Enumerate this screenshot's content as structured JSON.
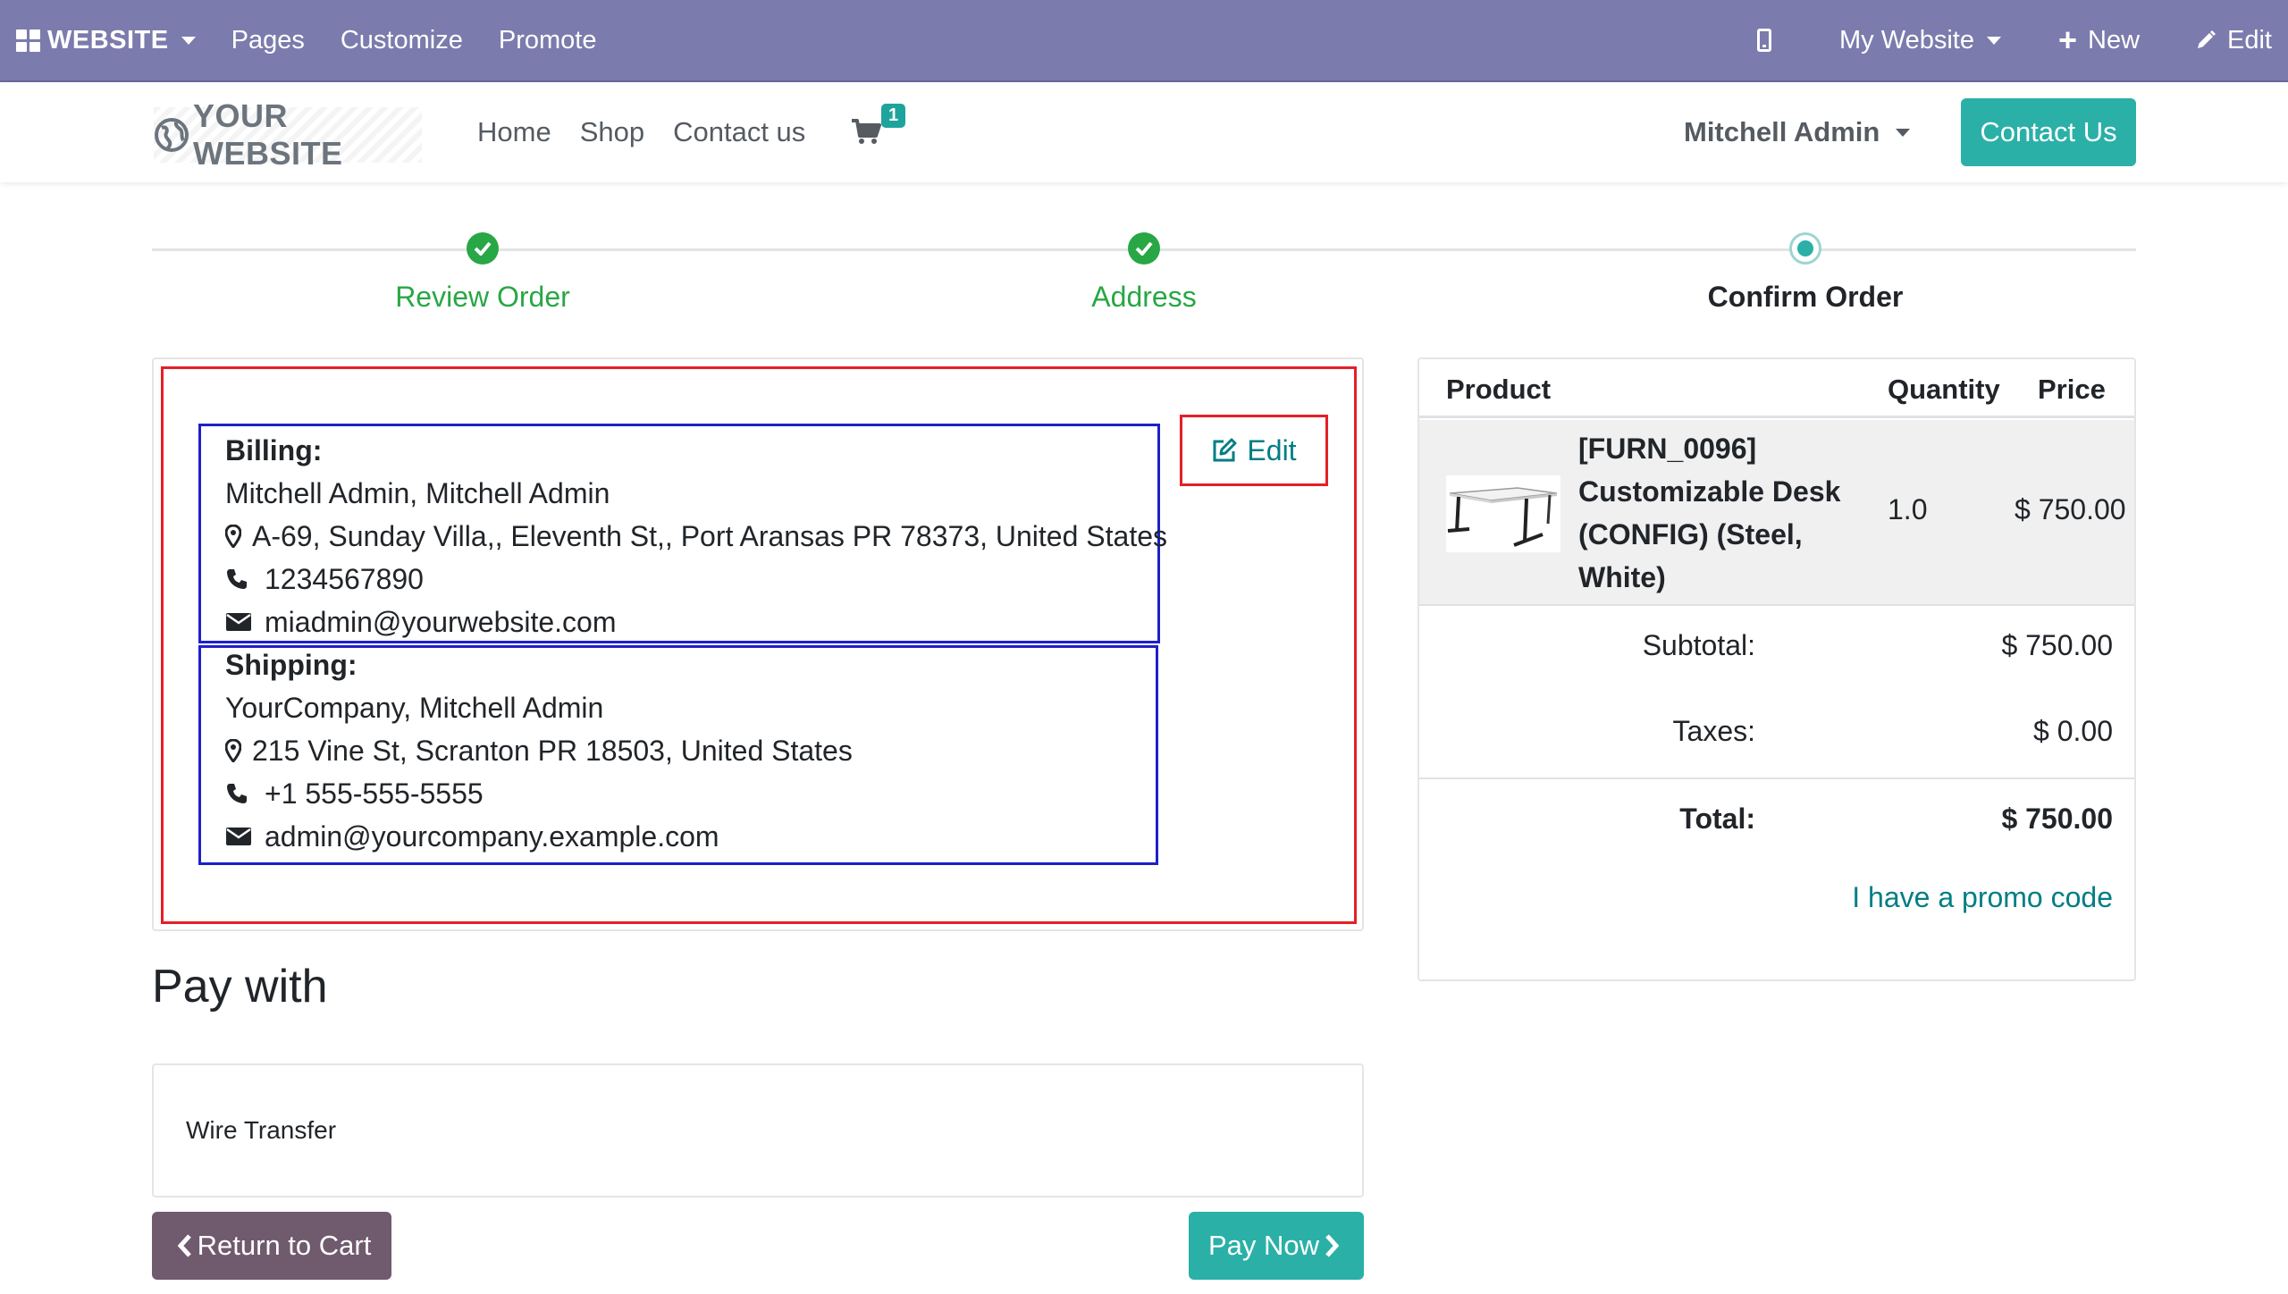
{
  "adminbar": {
    "brand": "WEBSITE",
    "menu": [
      "Pages",
      "Customize",
      "Promote"
    ],
    "site_selector": "My Website",
    "new_label": "New",
    "edit_label": "Edit",
    "bg_color": "#7c7bad"
  },
  "navbar": {
    "logo_text": "YOUR WEBSITE",
    "links": [
      "Home",
      "Shop",
      "Contact us"
    ],
    "cart_count": "1",
    "user": "Mitchell Admin",
    "contact_button": "Contact Us"
  },
  "wizard": {
    "steps": [
      {
        "label": "Review Order",
        "state": "done"
      },
      {
        "label": "Address",
        "state": "done"
      },
      {
        "label": "Confirm Order",
        "state": "current"
      }
    ]
  },
  "billing": {
    "title": "Billing:",
    "name": "Mitchell Admin, Mitchell Admin",
    "address": "A-69, Sunday Villa,, Eleventh St,, Port Aransas PR 78373, United States",
    "phone": "1234567890",
    "email": "miadmin@yourwebsite.com"
  },
  "shipping": {
    "title": "Shipping:",
    "name": "YourCompany, Mitchell Admin",
    "address": "215 Vine St, Scranton PR 18503, United States",
    "phone": "+1 555-555-5555",
    "email": "admin@yourcompany.example.com"
  },
  "edit_button": "Edit",
  "payment": {
    "title": "Pay with",
    "method": "Wire Transfer",
    "return_label": "Return to Cart",
    "pay_label": "Pay Now"
  },
  "summary": {
    "headers": {
      "product": "Product",
      "quantity": "Quantity",
      "price": "Price"
    },
    "product": {
      "line1": "[FURN_0096]",
      "line2": "Customizable Desk",
      "line3": "(CONFIG) (Steel,",
      "line4": "White)",
      "quantity": "1.0",
      "price": "$ 750.00"
    },
    "subtotal_label": "Subtotal:",
    "subtotal": "$ 750.00",
    "taxes_label": "Taxes:",
    "taxes": "$ 0.00",
    "total_label": "Total:",
    "total": "$ 750.00",
    "promo_link": "I have a promo code"
  }
}
